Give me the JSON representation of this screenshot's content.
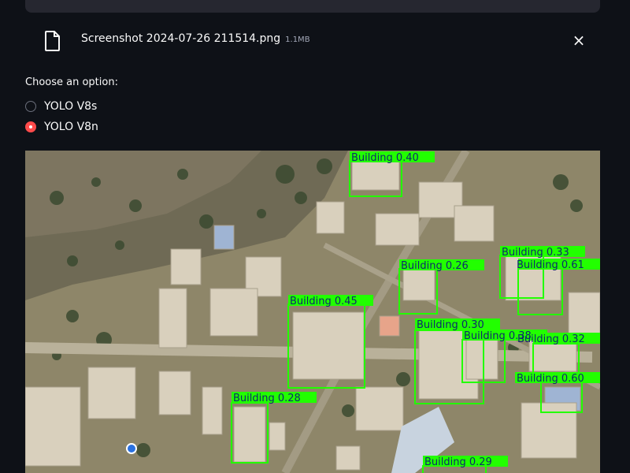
{
  "file": {
    "name": "Screenshot 2024-07-26 211514.png",
    "size": "1.1MB",
    "close_label": "×"
  },
  "model_select": {
    "label": "Choose an option:",
    "options": [
      {
        "label": "YOLO V8s",
        "selected": false
      },
      {
        "label": "YOLO V8n",
        "selected": true
      }
    ]
  },
  "detections": [
    {
      "label": "Building 0.40"
    },
    {
      "label": "Building 0.33"
    },
    {
      "label": "Building 0.61"
    },
    {
      "label": "Building 0.26"
    },
    {
      "label": "Building 0.45"
    },
    {
      "label": "Building 0.30"
    },
    {
      "label": "Building 0.38"
    },
    {
      "label": "Building 0.32"
    },
    {
      "label": "Building 0.60"
    },
    {
      "label": "Building 0.28"
    },
    {
      "label": "Building 0.29"
    }
  ],
  "colors": {
    "background": "#0e1117",
    "accent": "#ff4b4b",
    "box": "#22ff00",
    "ground": "#8e8669"
  }
}
